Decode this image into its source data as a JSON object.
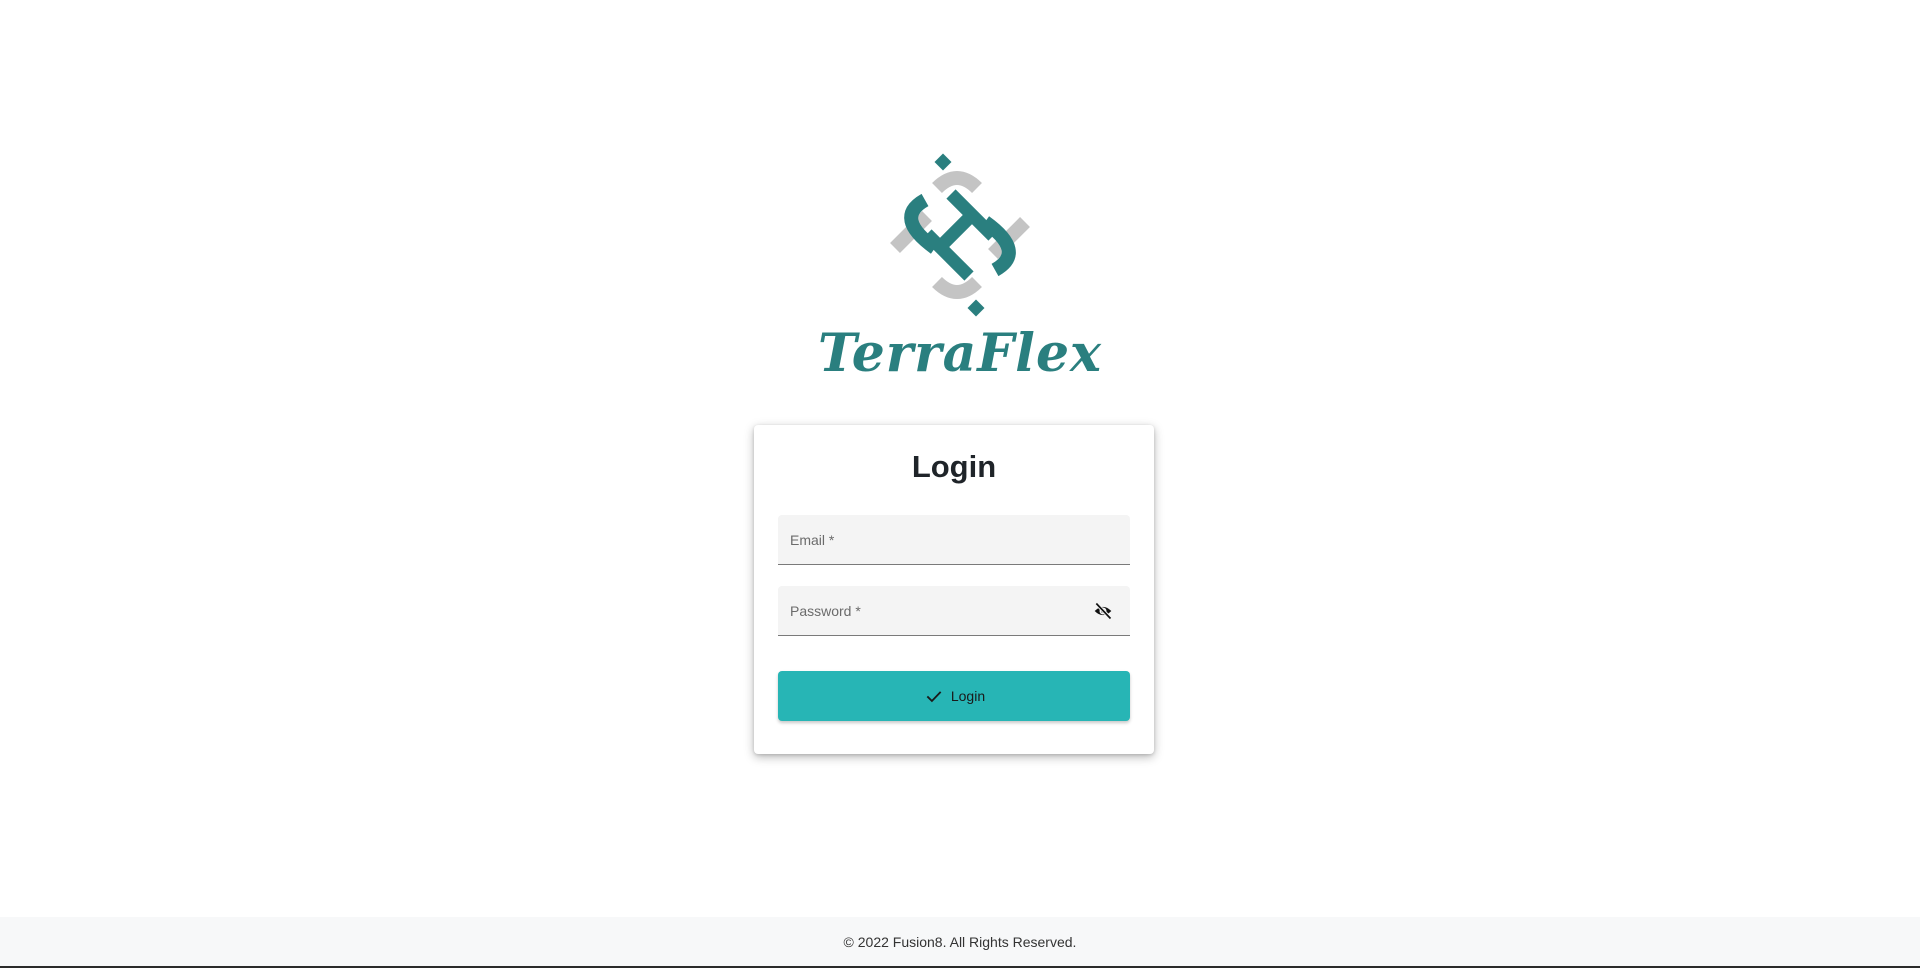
{
  "brand": {
    "name": "TerraFlex",
    "logo_icon": "terraflex-logo-icon",
    "accent_color": "#2a7f7f"
  },
  "login": {
    "title": "Login",
    "email_placeholder": "Email *",
    "password_placeholder": "Password *",
    "visibility_icon": "eye-off-icon",
    "button_label": "Login",
    "button_icon": "check-icon",
    "button_color": "#27b5b5"
  },
  "footer": {
    "text": "© 2022 Fusion8. All Rights Reserved."
  }
}
